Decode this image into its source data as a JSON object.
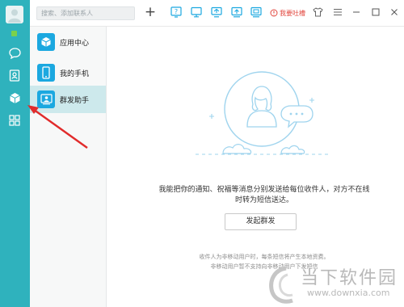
{
  "colors": {
    "rail": "#2fb2bd",
    "accent": "#1ba8e0",
    "active_nav": "#cde9ec",
    "feedback": "#e2483f",
    "illustration": "#9fd4ee",
    "annotation_arrow": "#e12b2b"
  },
  "search": {
    "placeholder": "搜索、添加联系人"
  },
  "toolbar": {
    "add_label": "+",
    "feedback_label": "我要吐槽",
    "icons": [
      "help-icon",
      "monitor-icon",
      "cast-icon",
      "upload-icon",
      "screen-icon",
      "feedback-icon",
      "shirt-icon",
      "menu-icon",
      "minimize-icon",
      "maximize-icon",
      "close-icon"
    ]
  },
  "rail": {
    "icons": [
      "avatar",
      "status-online",
      "chat-icon",
      "contacts-icon",
      "app-cube-icon",
      "grid-icon"
    ]
  },
  "nav": {
    "items": [
      {
        "label": "应用中心",
        "icon": "cube-icon"
      },
      {
        "label": "我的手机",
        "icon": "phone-icon"
      },
      {
        "label": "群发助手",
        "icon": "group-send-icon",
        "active": true
      }
    ]
  },
  "main": {
    "description_line1": "我能把你的通知、祝福等消息分别发送给每位收件人，对方不在线",
    "description_line2": "时转为短信送达。",
    "launch_button": "发起群发",
    "note_line1": "收件人为非移动用户时，每条短信将产生本地资费。",
    "note_line2": "非移动用户暂不支持向非移动用户下发短信"
  },
  "watermark": {
    "text": "当下软件园",
    "url": "www.downxia.com"
  }
}
